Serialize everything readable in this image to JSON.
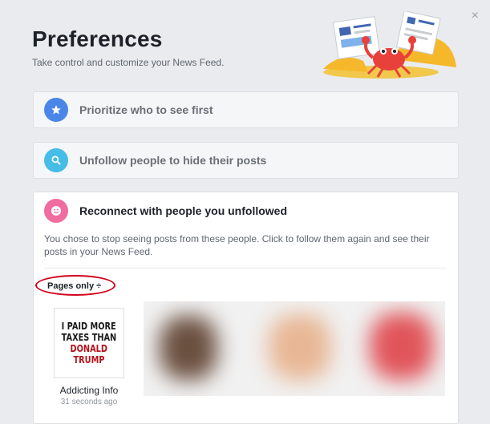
{
  "header": {
    "title": "Preferences",
    "subtitle": "Take control and customize your News Feed.",
    "close_icon": "×"
  },
  "options": [
    {
      "label": "Prioritize who to see first",
      "icon": "star-icon",
      "color": "#4a86e8"
    },
    {
      "label": "Unfollow people to hide their posts",
      "icon": "search-icon",
      "color": "#45bde6"
    }
  ],
  "reconnect": {
    "label": "Reconnect with people you unfollowed",
    "icon": "smiley-icon",
    "color": "#f06da0",
    "description": "You chose to stop seeing posts from these people. Click to follow them again and see their posts in your News Feed.",
    "filter": "Pages only ÷",
    "pages": [
      {
        "thumb_lines": [
          "I PAID MORE",
          "TAXES THAN",
          "DONALD",
          "TRUMP"
        ],
        "name": "Addicting Info",
        "time": "31 seconds ago"
      }
    ]
  },
  "colors": {
    "background": "#e9ebee",
    "highlight_ring": "#d0021b",
    "thumb_black": "#1a1a1a",
    "thumb_red": "#b3121a"
  }
}
